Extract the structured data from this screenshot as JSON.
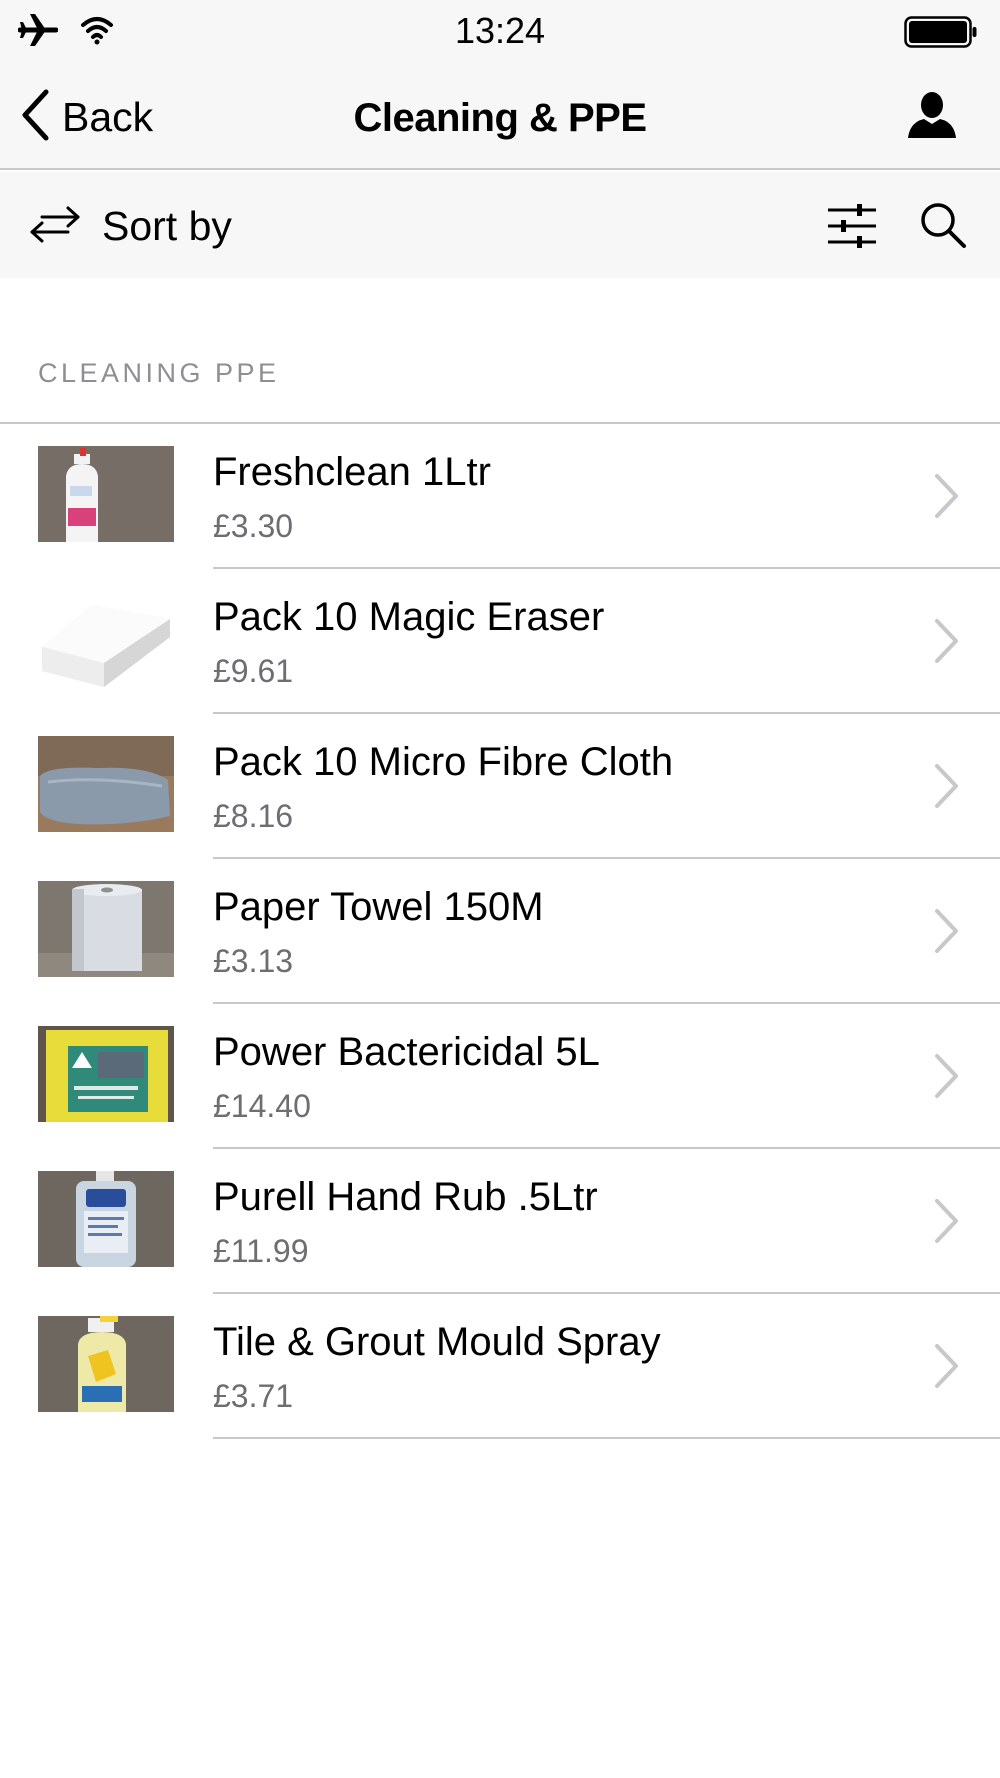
{
  "status_bar": {
    "time": "13:24"
  },
  "nav": {
    "back_label": "Back",
    "title": "Cleaning & PPE"
  },
  "toolbar": {
    "sort_label": "Sort by"
  },
  "section": {
    "header": "CLEANING PPE"
  },
  "products": [
    {
      "name": "Freshclean 1Ltr",
      "price": "£3.30",
      "thumb": "spray-bottle-pink"
    },
    {
      "name": "Pack 10 Magic Eraser",
      "price": "£9.61",
      "thumb": "white-sponge"
    },
    {
      "name": "Pack 10 Micro Fibre Cloth",
      "price": "£8.16",
      "thumb": "cloth-pack"
    },
    {
      "name": "Paper Towel 150M",
      "price": "£3.13",
      "thumb": "paper-roll"
    },
    {
      "name": "Power Bactericidal 5L",
      "price": "£14.40",
      "thumb": "yellow-canister"
    },
    {
      "name": "Purell Hand Rub .5Ltr",
      "price": "£11.99",
      "thumb": "pump-bottle"
    },
    {
      "name": "Tile & Grout Mould Spray",
      "price": "£3.71",
      "thumb": "yellow-spray-bottle"
    }
  ],
  "colors": {
    "bar_background": "#f7f7f7",
    "divider": "#c8c8c8",
    "secondary_text": "#6d6d72",
    "chevron": "#c7c7cc"
  }
}
